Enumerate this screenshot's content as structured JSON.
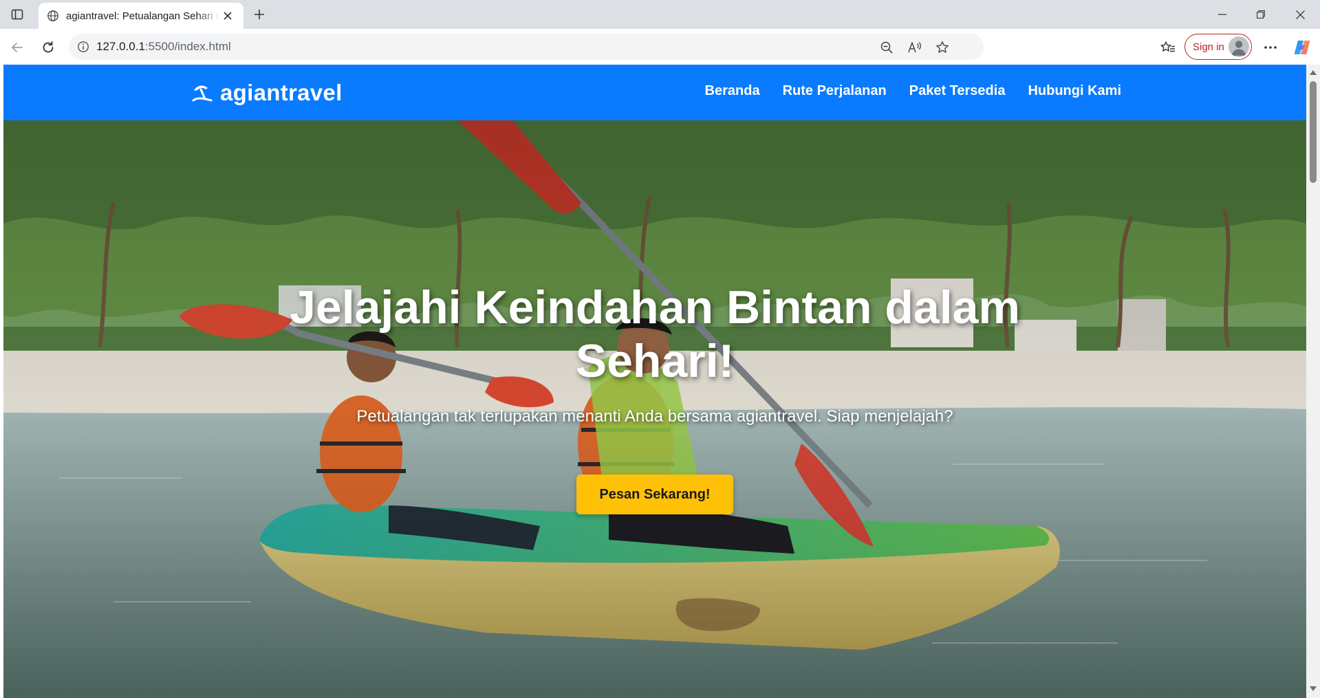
{
  "browser": {
    "tab_title": "agiantravel: Petualangan Sehari di Bintan",
    "address_host": "127.0.0.1",
    "address_rest": ":5500/index.html",
    "sign_in_label": "Sign in",
    "icons": {
      "sidebar": "sidebar-icon",
      "page": "globe-icon",
      "close": "close-icon",
      "new_tab": "plus-icon",
      "back": "arrow-left-icon",
      "reload": "reload-icon",
      "info": "info-icon",
      "zoom": "zoom-out-icon",
      "read_aloud": "read-aloud-icon",
      "favorite": "star-icon",
      "favorites": "favorites-icon",
      "more": "more-icon",
      "copilot": "copilot-icon"
    }
  },
  "site": {
    "brand": "agiantravel",
    "brand_icon": "umbrella-beach-icon",
    "nav": [
      "Beranda",
      "Rute Perjalanan",
      "Paket Tersedia",
      "Hubungi Kami"
    ],
    "colors": {
      "navbar": "#0a7bff",
      "cta": "#ffc107"
    }
  },
  "hero": {
    "title": "Jelajahi Keindahan Bintan dalam Sehari!",
    "subtitle": "Petualangan tak terlupakan menanti Anda bersama agiantravel. Siap menjelajah?",
    "cta_label": "Pesan Sekarang!"
  }
}
